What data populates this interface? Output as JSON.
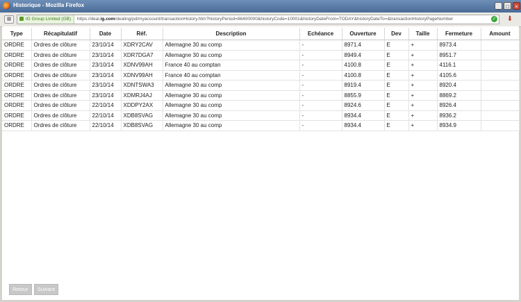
{
  "window": {
    "title": "Historique - Mozilla Firefox"
  },
  "urlbar": {
    "identity": "IG Group Limited (GB)",
    "url_prefix": "https://deal.",
    "url_domain": "ig.com",
    "url_path": "/dealing/pd/myaccount/transactionHistory.htm?historyPeriod=86400000&historyCode=10001&historyDateFrom=TODAY&historyDateTo=&transactionHistoryPageNumber"
  },
  "table": {
    "headers": [
      "Type",
      "Récapitulatif",
      "Date",
      "Réf.",
      "Description",
      "Echéance",
      "Ouverture",
      "Dev",
      "Taille",
      "Fermeture",
      "Amount"
    ],
    "rows": [
      [
        "ORDRE",
        "Ordres de clôture",
        "23/10/14",
        "XDRY2CAV",
        "Allemagne 30 au comp",
        "-",
        "8971.4",
        "E",
        "+",
        "8973.4",
        ""
      ],
      [
        "ORDRE",
        "Ordres de clôture",
        "23/10/14",
        "XDR7DGA7",
        "Allemagne 30 au comp",
        "-",
        "8949.4",
        "E",
        "+",
        "8951.7",
        ""
      ],
      [
        "ORDRE",
        "Ordres de clôture",
        "23/10/14",
        "XDNV99AH",
        "France 40 au comptan",
        "-",
        "4100.8",
        "E",
        "+",
        "4116.1",
        ""
      ],
      [
        "ORDRE",
        "Ordres de clôture",
        "23/10/14",
        "XDNV99AH",
        "France 40 au comptan",
        "-",
        "4100.8",
        "E",
        "+",
        "4105.6",
        ""
      ],
      [
        "ORDRE",
        "Ordres de clôture",
        "23/10/14",
        "XDNTSWA3",
        "Allemagne 30 au comp",
        "-",
        "8919.4",
        "E",
        "+",
        "8920.4",
        ""
      ],
      [
        "ORDRE",
        "Ordres de clôture",
        "23/10/14",
        "XDMRJ4AJ",
        "Allemagne 30 au comp",
        "-",
        "8855.9",
        "E",
        "+",
        "8869.2",
        ""
      ],
      [
        "ORDRE",
        "Ordres de clôture",
        "22/10/14",
        "XDDPY2AX",
        "Allemagne 30 au comp",
        "-",
        "8924.6",
        "E",
        "+",
        "8926.4",
        ""
      ],
      [
        "ORDRE",
        "Ordres de clôture",
        "22/10/14",
        "XDB8SVAG",
        "Allemagne 30 au comp",
        "-",
        "8934.4",
        "E",
        "+",
        "8936.2",
        ""
      ],
      [
        "ORDRE",
        "Ordres de clôture",
        "22/10/14",
        "XDB8SVAG",
        "Allemagne 30 au comp",
        "-",
        "8934.4",
        "E",
        "+",
        "8934.9",
        ""
      ]
    ]
  },
  "pagination": {
    "back_label": "Retour",
    "next_label": "Suivant"
  }
}
